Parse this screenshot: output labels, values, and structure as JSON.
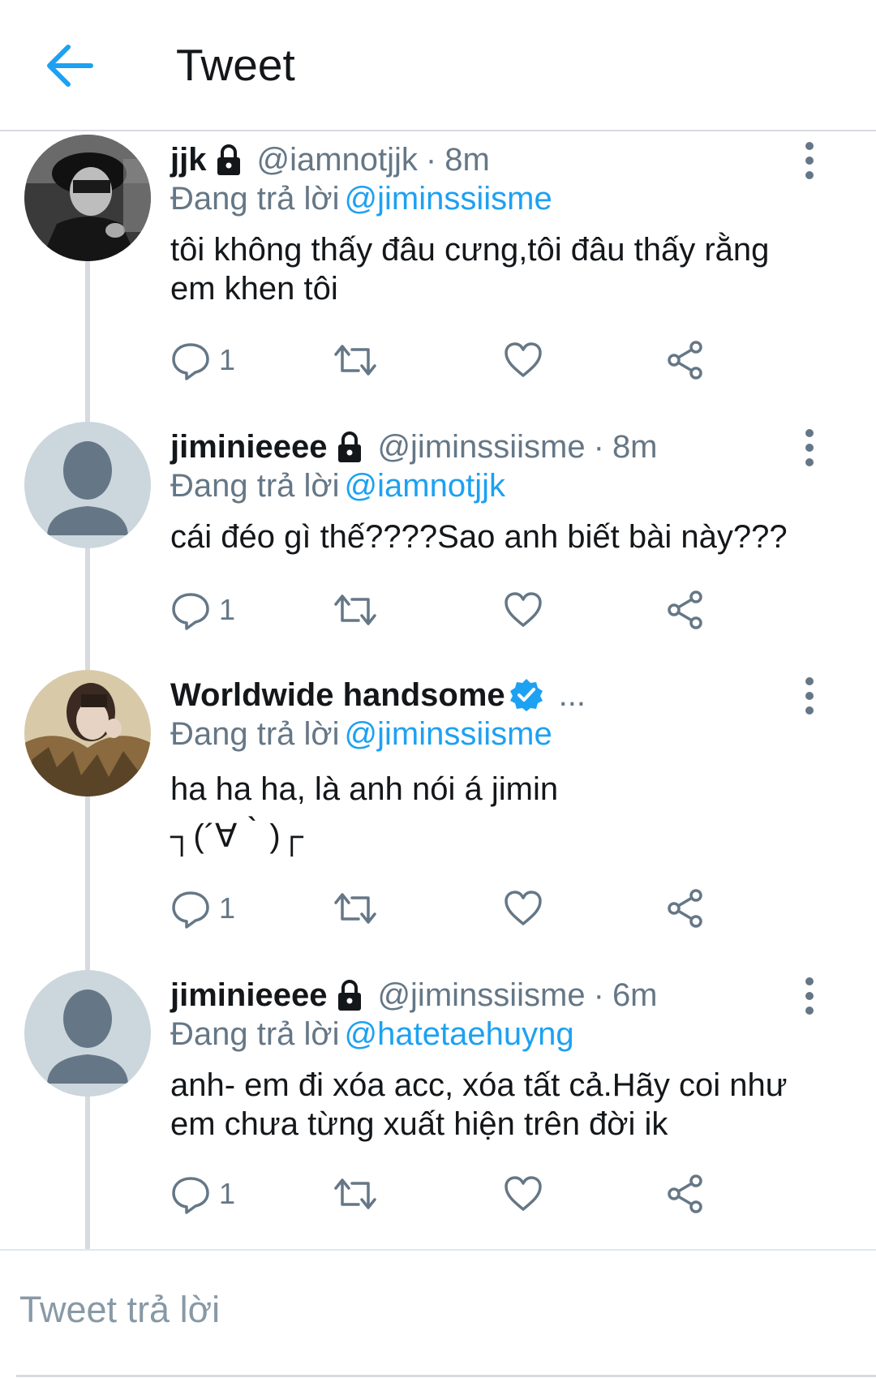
{
  "header": {
    "title": "Tweet",
    "back_icon": "arrow-left-icon",
    "accent_color": "#1da1f2"
  },
  "tweets": [
    {
      "display_name": "jjk",
      "protected": true,
      "verified": false,
      "handle": "@iamnotjjk",
      "separator": "·",
      "time": "8m",
      "reply_label": "Đang trả lời",
      "reply_to": "@jiminssiisme",
      "text_lines": [
        "tôi không thấy đâu cưng,tôi đâu thấy rằng",
        "em khen tôi"
      ],
      "reply_count": "1"
    },
    {
      "display_name": "jiminieeee",
      "protected": true,
      "verified": false,
      "handle": "@jiminssiisme",
      "separator": "·",
      "time": "8m",
      "reply_label": "Đang trả lời",
      "reply_to": "@iamnotjjk",
      "text_lines": [
        "cái đéo gì thế????Sao anh biết bài này???"
      ],
      "reply_count": "1"
    },
    {
      "display_name": "Worldwide handsome",
      "protected": false,
      "verified": true,
      "truncated_marker": "...",
      "reply_label": "Đang trả lời",
      "reply_to": "@jiminssiisme",
      "text_lines": [
        "ha ha ha, là anh nói á jimin",
        "┐(´∀｀)┌"
      ],
      "reply_count": "1"
    },
    {
      "display_name": "jiminieeee",
      "protected": true,
      "verified": false,
      "handle": "@jiminssiisme",
      "separator": "·",
      "time": "6m",
      "reply_label": "Đang trả lời",
      "reply_to": "@hatetaehuyng",
      "text_lines": [
        "anh- em đi xóa acc, xóa tất cả.Hãy coi như",
        "em chưa từng xuất hiện trên đời ik"
      ],
      "reply_count": "1"
    }
  ],
  "compose": {
    "placeholder": "Tweet trả lời"
  },
  "icons": {
    "reply": "reply-icon",
    "retweet": "retweet-icon",
    "like": "heart-icon",
    "share": "share-icon",
    "more": "more-vertical-icon",
    "lock": "lock-icon",
    "verified": "verified-badge-icon"
  }
}
